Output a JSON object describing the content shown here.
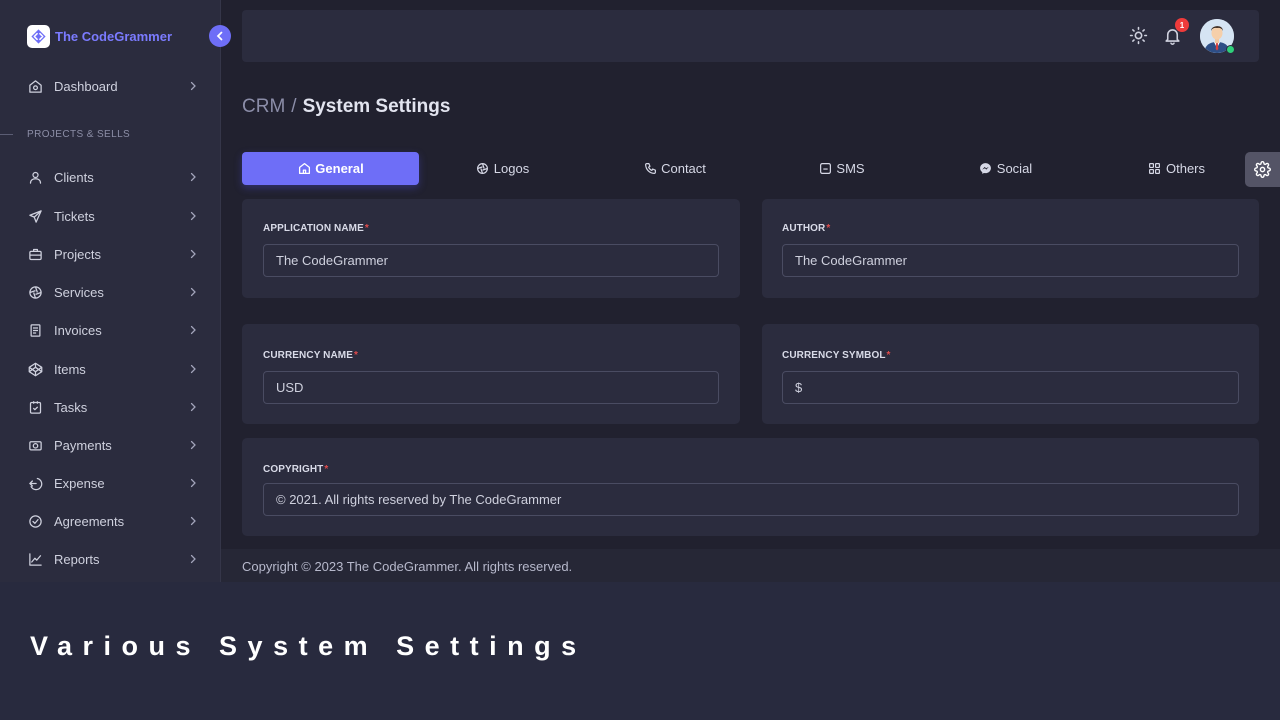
{
  "brand": {
    "name": "The CodeGrammer"
  },
  "sidebar": {
    "dashboard": "Dashboard",
    "section_label": "PROJECTS & SELLS",
    "items": [
      {
        "label": "Clients",
        "icon": "user-icon"
      },
      {
        "label": "Tickets",
        "icon": "send-icon"
      },
      {
        "label": "Projects",
        "icon": "briefcase-icon"
      },
      {
        "label": "Services",
        "icon": "aperture-icon"
      },
      {
        "label": "Invoices",
        "icon": "invoice-icon"
      },
      {
        "label": "Items",
        "icon": "codepen-icon"
      },
      {
        "label": "Tasks",
        "icon": "task-icon"
      },
      {
        "label": "Payments",
        "icon": "camera-icon"
      },
      {
        "label": "Expense",
        "icon": "logout-icon"
      },
      {
        "label": "Agreements",
        "icon": "check-circle-icon"
      },
      {
        "label": "Reports",
        "icon": "chart-icon"
      }
    ]
  },
  "topbar": {
    "notification_count": "1"
  },
  "breadcrumb": {
    "parent": "CRM",
    "separator": "/",
    "current": "System Settings"
  },
  "tabs": [
    {
      "label": "General",
      "icon": "home-icon",
      "active": true
    },
    {
      "label": "Logos",
      "icon": "aperture-icon",
      "active": false
    },
    {
      "label": "Contact",
      "icon": "phone-icon",
      "active": false
    },
    {
      "label": "SMS",
      "icon": "message-square-icon",
      "active": false
    },
    {
      "label": "Social",
      "icon": "messenger-icon",
      "active": false
    },
    {
      "label": "Others",
      "icon": "grid-icon",
      "active": false
    }
  ],
  "form": {
    "application_name": {
      "label": "APPLICATION NAME",
      "required": "*",
      "value": "The CodeGrammer"
    },
    "author": {
      "label": "AUTHOR",
      "required": "*",
      "value": "The CodeGrammer"
    },
    "currency_name": {
      "label": "CURRENCY NAME",
      "required": "*",
      "value": "USD"
    },
    "currency_symbol": {
      "label": "CURRENCY SYMBOL",
      "required": "*",
      "value": "$"
    },
    "copyright": {
      "label": "COPYRIGHT",
      "required": "*",
      "value": "© 2021. All rights reserved by The CodeGrammer"
    }
  },
  "footer": {
    "text": "Copyright © 2023 The CodeGrammer. All rights reserved."
  },
  "caption": "Various System Settings",
  "colors": {
    "accent": "#6e6ef7",
    "background": "#21212f",
    "card": "#2b2c3e",
    "badge": "#ef3b3b",
    "online": "#2fd07a"
  }
}
